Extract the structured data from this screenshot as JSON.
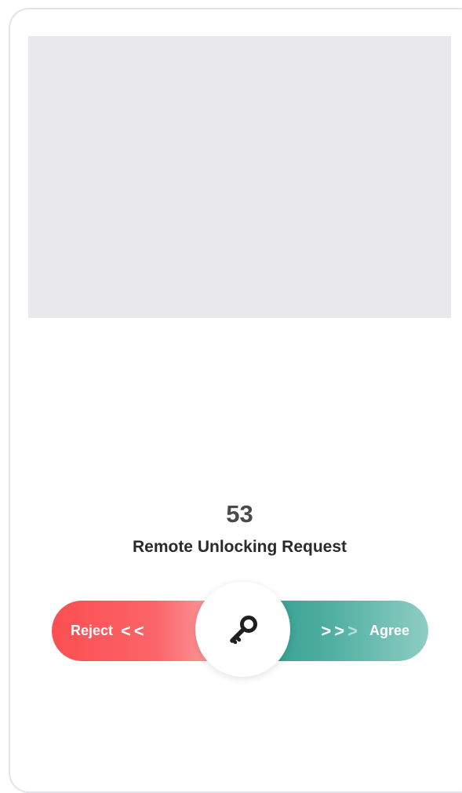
{
  "request": {
    "countdown": "53",
    "title": "Remote Unlocking Request"
  },
  "slider": {
    "reject_label": "Reject",
    "agree_label": "Agree",
    "chevron_left": "<",
    "chevron_right": ">",
    "knob_icon": "key-icon"
  },
  "colors": {
    "reject": "#fb4f52",
    "agree": "#2a9b8a",
    "preview_bg": "#e8e8ea"
  }
}
